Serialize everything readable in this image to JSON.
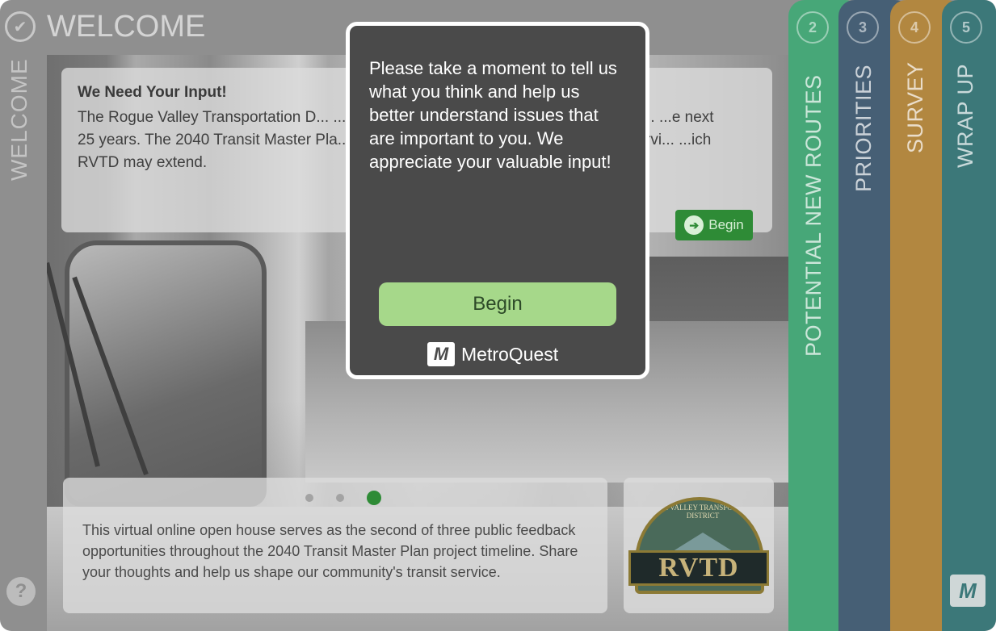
{
  "welcome": {
    "title": "WELCOME",
    "vertical_label": "WELCOME",
    "help_symbol": "?",
    "check_icon": "check-circle-icon"
  },
  "info_card": {
    "heading": "We Need Your Input!",
    "text": "The Rogue Valley Transportation D... ...ansion in 2019 and beginning a process to i... ...e next 25 years. The 2040 Transit Master Pla... ...n transit service needs for the existing servi... ...ich RVTD may extend.",
    "begin_label": "Begin"
  },
  "bottom_card": {
    "text": "This virtual online open house serves as the second of three public feedback opportunities throughout the 2040 Transit Master Plan project timeline. Share your thoughts and help us shape our community's transit service.",
    "carousel": {
      "count": 3,
      "active_index": 2
    }
  },
  "logo": {
    "arc_text": "ROGUE VALLEY TRANSPORTATION DISTRICT",
    "name": "RVTD"
  },
  "tabs": [
    {
      "number": "2",
      "label": "POTENTIAL NEW ROUTES",
      "color": "#47a778"
    },
    {
      "number": "3",
      "label": "PRIORITIES",
      "color": "#465f75"
    },
    {
      "number": "4",
      "label": "SURVEY",
      "color": "#b28740"
    },
    {
      "number": "5",
      "label": "WRAP UP",
      "color": "#3c7879"
    }
  ],
  "modal": {
    "message": "Please take a moment to tell us what you think and help us better understand issues that are important to you. We appreciate your valuable input!",
    "begin_label": "Begin",
    "brand": "MetroQuest"
  }
}
